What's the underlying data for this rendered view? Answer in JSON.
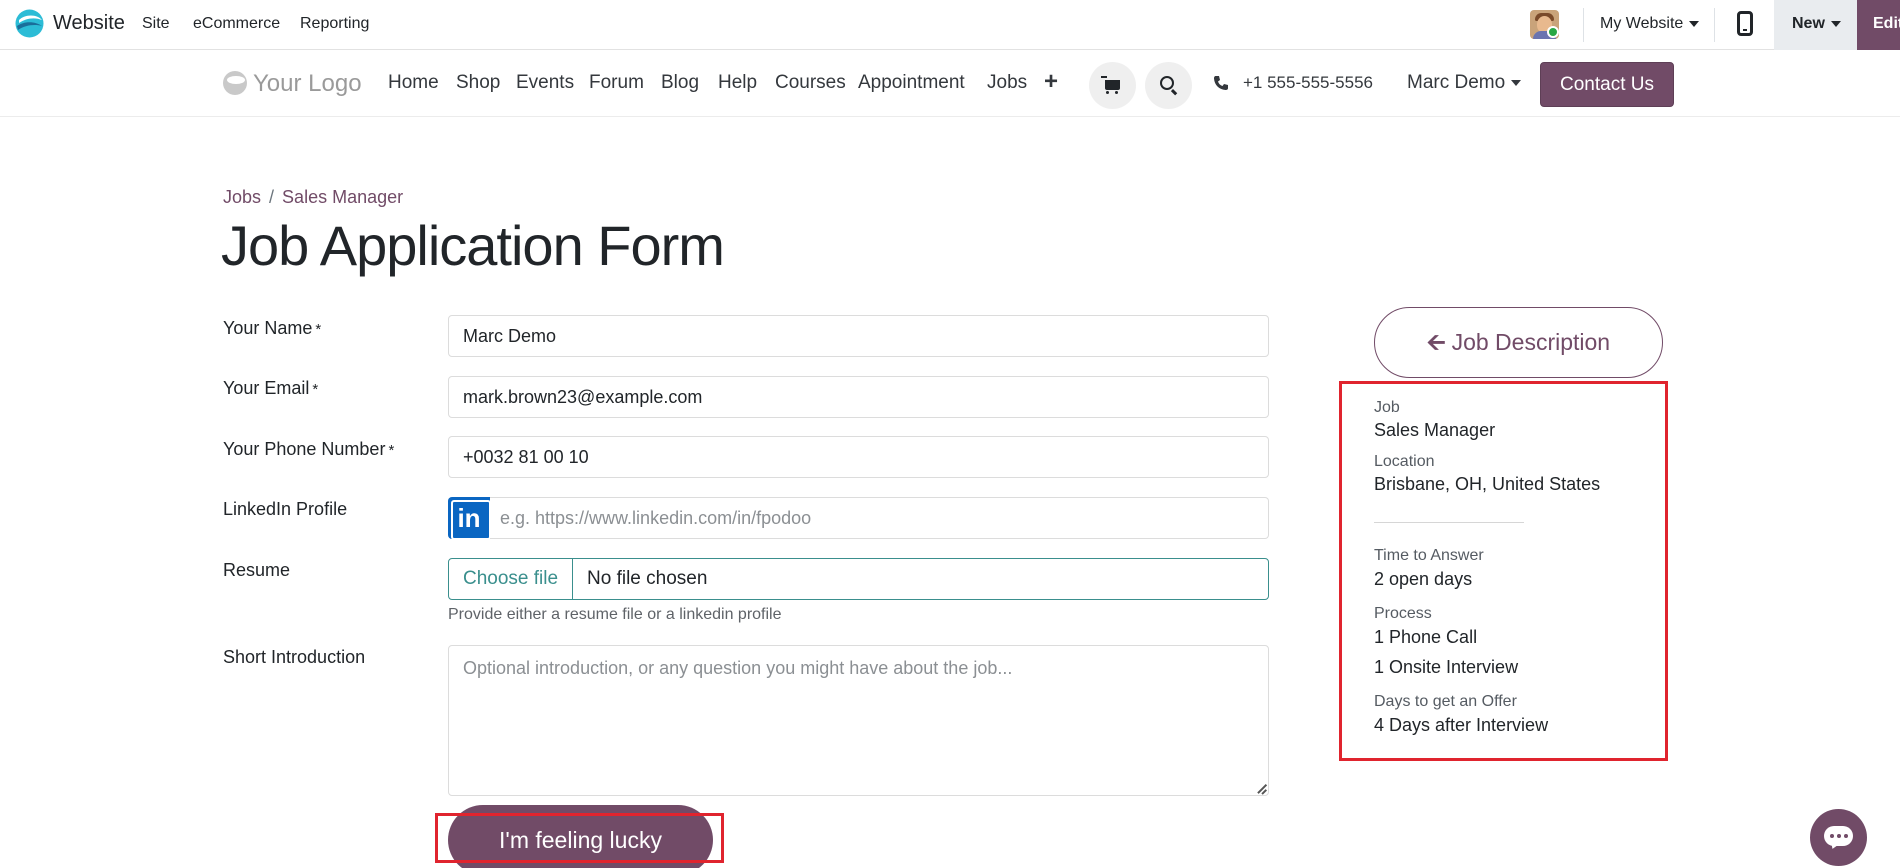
{
  "admin_bar": {
    "brand": "Website",
    "menu": [
      "Site",
      "eCommerce",
      "Reporting"
    ],
    "website_selector": "My Website",
    "new_label": "New",
    "edit_label": "Edit",
    "accent_color": "#714b67"
  },
  "site_header": {
    "logo_text": "Your Logo",
    "nav": [
      "Home",
      "Shop",
      "Events",
      "Forum",
      "Blog",
      "Help",
      "Courses",
      "Appointment",
      "Jobs"
    ],
    "add_glyph": "+",
    "phone": "+1 555-555-5556",
    "user": "Marc Demo",
    "contact_button": "Contact Us"
  },
  "breadcrumb": {
    "parent": "Jobs",
    "separator": "/",
    "current": "Sales Manager"
  },
  "page_title": "Job Application Form",
  "form": {
    "required_mark": "*",
    "name": {
      "label": "Your Name",
      "value": "Marc Demo"
    },
    "email": {
      "label": "Your Email",
      "value": "mark.brown23@example.com"
    },
    "phone": {
      "label": "Your Phone Number",
      "value": "+0032 81 00 10"
    },
    "linkedin": {
      "label": "LinkedIn Profile",
      "icon_text": "in",
      "placeholder": "e.g. https://www.linkedin.com/in/fpodoo"
    },
    "resume": {
      "label": "Resume",
      "choose_label": "Choose file",
      "file_status": "No file chosen",
      "help": "Provide either a resume file or a linkedin profile"
    },
    "introduction": {
      "label": "Short Introduction",
      "placeholder": "Optional introduction, or any question you might have about the job..."
    },
    "submit_label": "I'm feeling lucky"
  },
  "sidebar": {
    "back_button": "Job Description",
    "job_label": "Job",
    "job_value": "Sales Manager",
    "location_label": "Location",
    "location_value": "Brisbane, OH, United States",
    "time_label": "Time to Answer",
    "time_value": "2 open days",
    "process_label": "Process",
    "process_steps": [
      "1 Phone Call",
      "1 Onsite Interview"
    ],
    "offer_label": "Days to get an Offer",
    "offer_value": "4 Days after Interview"
  }
}
